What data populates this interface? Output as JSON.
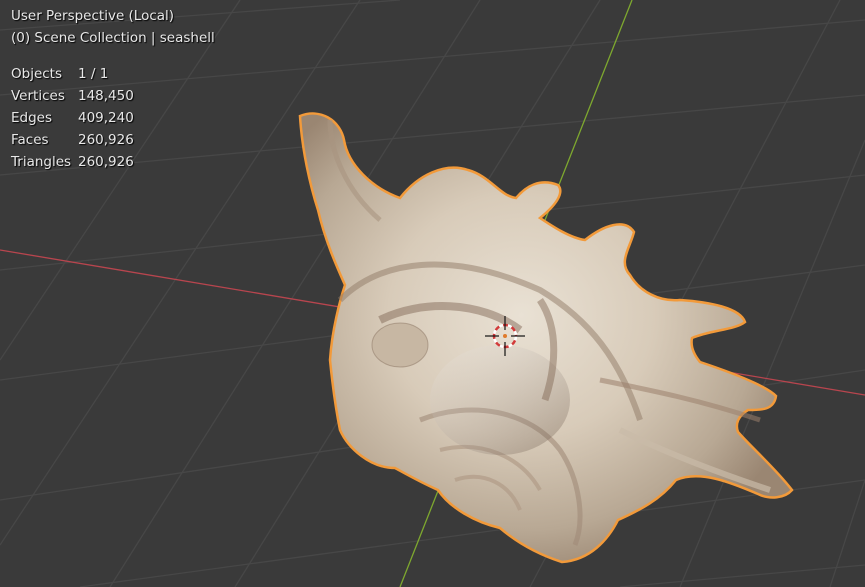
{
  "viewport": {
    "perspective_label": "User Perspective (Local)",
    "collection_label": "(0) Scene Collection | seashell"
  },
  "stats": [
    {
      "label": "Objects",
      "value": "1 / 1"
    },
    {
      "label": "Vertices",
      "value": "148,450"
    },
    {
      "label": "Edges",
      "value": "409,240"
    },
    {
      "label": "Faces",
      "value": "260,926"
    },
    {
      "label": "Triangles",
      "value": "260,926"
    }
  ],
  "colors": {
    "background": "#3a3a3a",
    "grid": "#474747",
    "x_axis": "#b8454e",
    "y_axis": "#7ea82f",
    "selection_outline": "#f29a3a",
    "shell_base": "#d8cdbd"
  },
  "icons": {
    "cursor": "3d-cursor-icon"
  }
}
